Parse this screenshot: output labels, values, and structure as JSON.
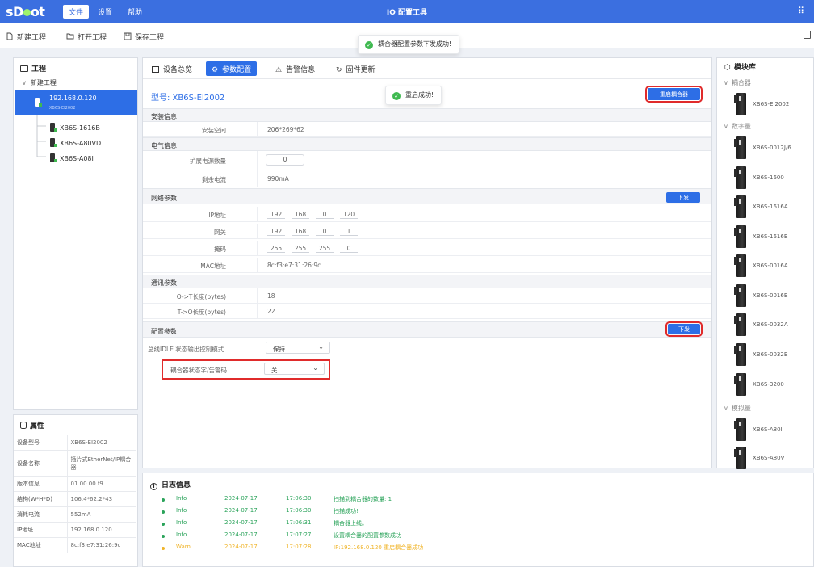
{
  "app": {
    "logo_text_left": "s",
    "logo_text_right": "ot",
    "title": "IO 配置工具",
    "menu": [
      "文件",
      "设置",
      "帮助"
    ],
    "window_controls": {
      "minimize": "−",
      "menu": "⠿"
    }
  },
  "toolbar": {
    "new_project": "新建工程",
    "open_project": "打开工程",
    "save_project": "保存工程",
    "toast": "耦合器配置参数下发成功!"
  },
  "project": {
    "title": "工程",
    "root": "新建工程",
    "selected": {
      "ip": "192.168.0.120",
      "model": "XB6S-EI2002"
    },
    "children": [
      "XB6S-1616B",
      "XB6S-A80VD",
      "XB6S-A08I"
    ]
  },
  "properties": {
    "title": "属性",
    "rows": [
      {
        "k": "设备型号",
        "v": "XB6S-EI2002"
      },
      {
        "k": "设备名称",
        "v": "插片式EtherNet/IP耦合器"
      },
      {
        "k": "版本信息",
        "v": "01.00.00.f9"
      },
      {
        "k": "结构(W*H*D)",
        "v": "106.4*62.2*43"
      },
      {
        "k": "消耗电流",
        "v": "552mA"
      },
      {
        "k": "IP地址",
        "v": "192.168.0.120"
      },
      {
        "k": "MAC地址",
        "v": "8c:f3:e7:31:26:9c"
      }
    ]
  },
  "tabs": [
    "设备总览",
    "参数配置",
    "告警信息",
    "固件更新"
  ],
  "config": {
    "model_label": "型号: XB6S-EI2002",
    "restart_toast": "重启成功!",
    "restart_button": "重启耦合器",
    "sections": {
      "install": "安装信息",
      "electric": "电气信息",
      "network": "网络参数",
      "comm": "通讯参数",
      "config": "配置参数"
    },
    "install_space_label": "安装空间",
    "install_space_value": "206*269*62",
    "ext_power_label": "扩展电源数量",
    "ext_power_value": "0",
    "remaining_current_label": "剩余电流",
    "remaining_current_value": "990mA",
    "send_label": "下发",
    "ip_label": "IP地址",
    "ip": [
      "192",
      "168",
      "0",
      "120"
    ],
    "gateway_label": "网关",
    "gateway": [
      "192",
      "168",
      "0",
      "1"
    ],
    "mask_label": "掩码",
    "mask": [
      "255",
      "255",
      "255",
      "0"
    ],
    "mac_label": "MAC地址",
    "mac_value": "8c:f3:e7:31:26:9c",
    "ot_label": "O->T长度(bytes)",
    "ot_value": "18",
    "to_label": "T->O长度(bytes)",
    "to_value": "22",
    "idle_label": "总线IDLE 状态输出控制模式",
    "idle_value": "保持",
    "status_label": "耦合器状态字/告警码",
    "status_value": "关"
  },
  "log": {
    "title": "日志信息",
    "rows": [
      {
        "level": "Info",
        "date": "2024-07-17",
        "time": "17:06:30",
        "msg": "扫描到耦合器的数量: 1"
      },
      {
        "level": "Info",
        "date": "2024-07-17",
        "time": "17:06:30",
        "msg": "扫描成功!"
      },
      {
        "level": "Info",
        "date": "2024-07-17",
        "time": "17:06:31",
        "msg": "耦合器上线。"
      },
      {
        "level": "Info",
        "date": "2024-07-17",
        "time": "17:07:27",
        "msg": "设置耦合器的配置参数成功"
      },
      {
        "level": "Warn",
        "date": "2024-07-17",
        "time": "17:07:28",
        "msg": "IP:192.168.0.120 重启耦合器成功"
      }
    ]
  },
  "library": {
    "title": "模块库",
    "categories": [
      "耦合器",
      "数字量",
      "模拟量"
    ],
    "coupler": [
      "XB6S-EI2002"
    ],
    "digital": [
      "XB6S-0012J/6",
      "XB6S-1600",
      "XB6S-1616A",
      "XB6S-1616B",
      "XB6S-0016A",
      "XB6S-0016B",
      "XB6S-0032A",
      "XB6S-0032B",
      "XB6S-3200"
    ],
    "analog": [
      "XB6S-A80I",
      "XB6S-A80V"
    ]
  },
  "colors": {
    "primary": "#2d6ee6",
    "titlebar": "#3b6fe0",
    "highlight": "#e02b2b",
    "success": "#3fb950",
    "warn": "#f0b429"
  }
}
